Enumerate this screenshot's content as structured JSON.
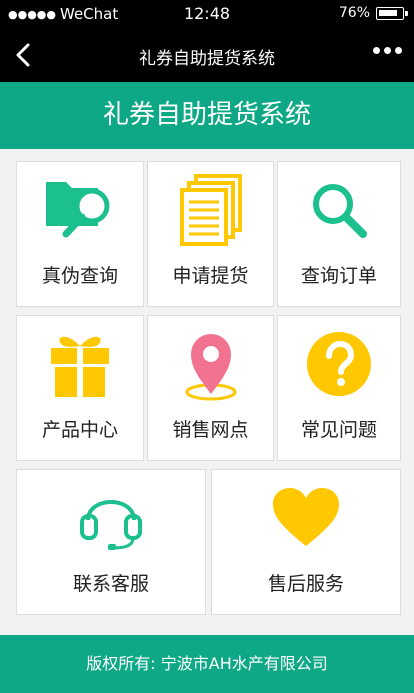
{
  "statusbar": {
    "carrier": "WeChat",
    "time": "12:48",
    "battery": "76%"
  },
  "navbar": {
    "title": "礼券自助提货系统"
  },
  "banner": {
    "title": "礼券自助提货系统"
  },
  "tiles": [
    {
      "label": "真伪查询",
      "icon": "folder-search-icon"
    },
    {
      "label": "申请提货",
      "icon": "documents-icon"
    },
    {
      "label": "查询订单",
      "icon": "search-icon"
    },
    {
      "label": "产品中心",
      "icon": "gift-icon"
    },
    {
      "label": "销售网点",
      "icon": "location-pin-icon"
    },
    {
      "label": "常见问题",
      "icon": "question-icon"
    },
    {
      "label": "联系客服",
      "icon": "headset-icon"
    },
    {
      "label": "售后服务",
      "icon": "heart-icon"
    }
  ],
  "footer": {
    "text": "版权所有:  宁波市AH水产有限公司"
  },
  "colors": {
    "accent": "#0ea887",
    "yellow": "#ffc800",
    "pink": "#f27390",
    "green_icon": "#1cc08f"
  }
}
